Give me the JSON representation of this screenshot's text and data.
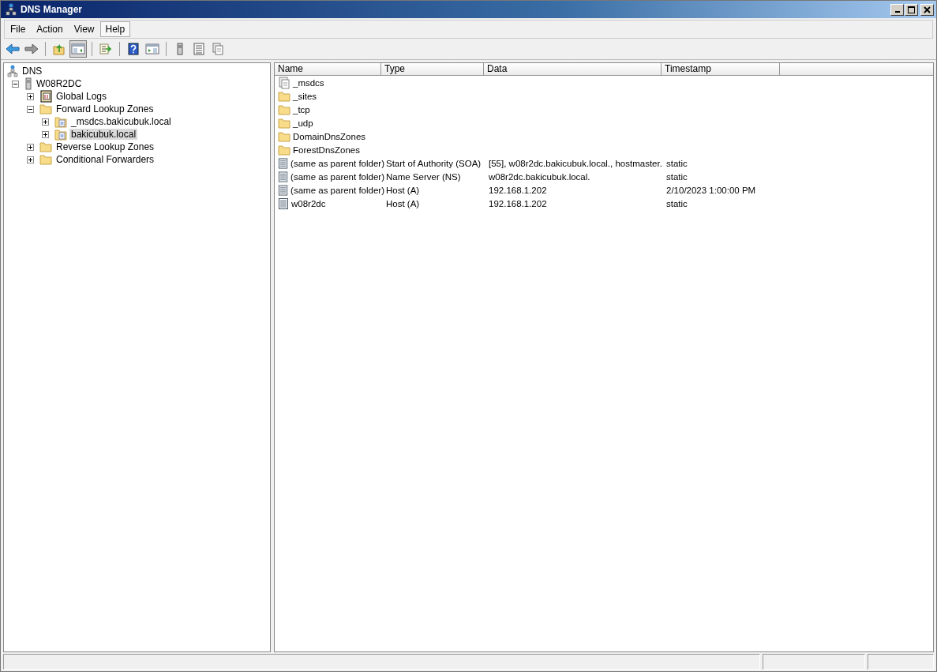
{
  "window": {
    "title": "DNS Manager"
  },
  "menu": [
    {
      "label": "File",
      "selected": false
    },
    {
      "label": "Action",
      "selected": false
    },
    {
      "label": "View",
      "selected": false
    },
    {
      "label": "Help",
      "selected": true
    }
  ],
  "toolbar": [
    [
      {
        "kind": "back",
        "pressed": false
      },
      {
        "kind": "forward",
        "pressed": false
      }
    ],
    [
      {
        "kind": "up",
        "pressed": false
      },
      {
        "kind": "tree",
        "pressed": true
      }
    ],
    [
      {
        "kind": "export",
        "pressed": false
      }
    ],
    [
      {
        "kind": "help",
        "pressed": false
      },
      {
        "kind": "pane",
        "pressed": false
      }
    ],
    [
      {
        "kind": "server",
        "pressed": false
      },
      {
        "kind": "list",
        "pressed": false
      },
      {
        "kind": "doc",
        "pressed": false
      }
    ]
  ],
  "tree": [
    {
      "label": "DNS",
      "kind": "dns",
      "selected": false,
      "children": [
        {
          "label": "W08R2DC",
          "kind": "server",
          "expanded": true,
          "selected": false,
          "children": [
            {
              "label": "Global Logs",
              "kind": "logs",
              "expanded": false,
              "selected": false
            },
            {
              "label": "Forward Lookup Zones",
              "kind": "folder",
              "expanded": true,
              "selected": false,
              "children": [
                {
                  "label": "_msdcs.bakicubuk.local",
                  "kind": "zone",
                  "expanded": false,
                  "selected": false
                },
                {
                  "label": "bakicubuk.local",
                  "kind": "zone",
                  "expanded": false,
                  "selected": true
                }
              ]
            },
            {
              "label": "Reverse Lookup Zones",
              "kind": "folder",
              "expanded": false,
              "selected": false
            },
            {
              "label": "Conditional Forwarders",
              "kind": "folder",
              "expanded": false,
              "selected": false
            }
          ]
        }
      ]
    }
  ],
  "table": {
    "columns": [
      "Name",
      "Type",
      "Data",
      "Timestamp"
    ],
    "rows": [
      {
        "kind": "zone",
        "cells": [
          "_msdcs",
          "",
          "",
          ""
        ]
      },
      {
        "kind": "folder",
        "cells": [
          "_sites",
          "",
          "",
          ""
        ]
      },
      {
        "kind": "folder",
        "cells": [
          "_tcp",
          "",
          "",
          ""
        ]
      },
      {
        "kind": "folder",
        "cells": [
          "_udp",
          "",
          "",
          ""
        ]
      },
      {
        "kind": "folder",
        "cells": [
          "DomainDnsZones",
          "",
          "",
          ""
        ]
      },
      {
        "kind": "folder",
        "cells": [
          "ForestDnsZones",
          "",
          "",
          ""
        ]
      },
      {
        "kind": "record",
        "cells": [
          "(same as parent folder)",
          "Start of Authority (SOA)",
          "[55], w08r2dc.bakicubuk.local., hostmaster.",
          "static"
        ]
      },
      {
        "kind": "record",
        "cells": [
          "(same as parent folder)",
          "Name Server (NS)",
          "w08r2dc.bakicubuk.local.",
          "static"
        ]
      },
      {
        "kind": "record",
        "cells": [
          "(same as parent folder)",
          "Host (A)",
          "192.168.1.202",
          "2/10/2023 1:00:00 PM"
        ]
      },
      {
        "kind": "record",
        "cells": [
          "w08r2dc",
          "Host (A)",
          "192.168.1.202",
          "static"
        ]
      }
    ]
  }
}
